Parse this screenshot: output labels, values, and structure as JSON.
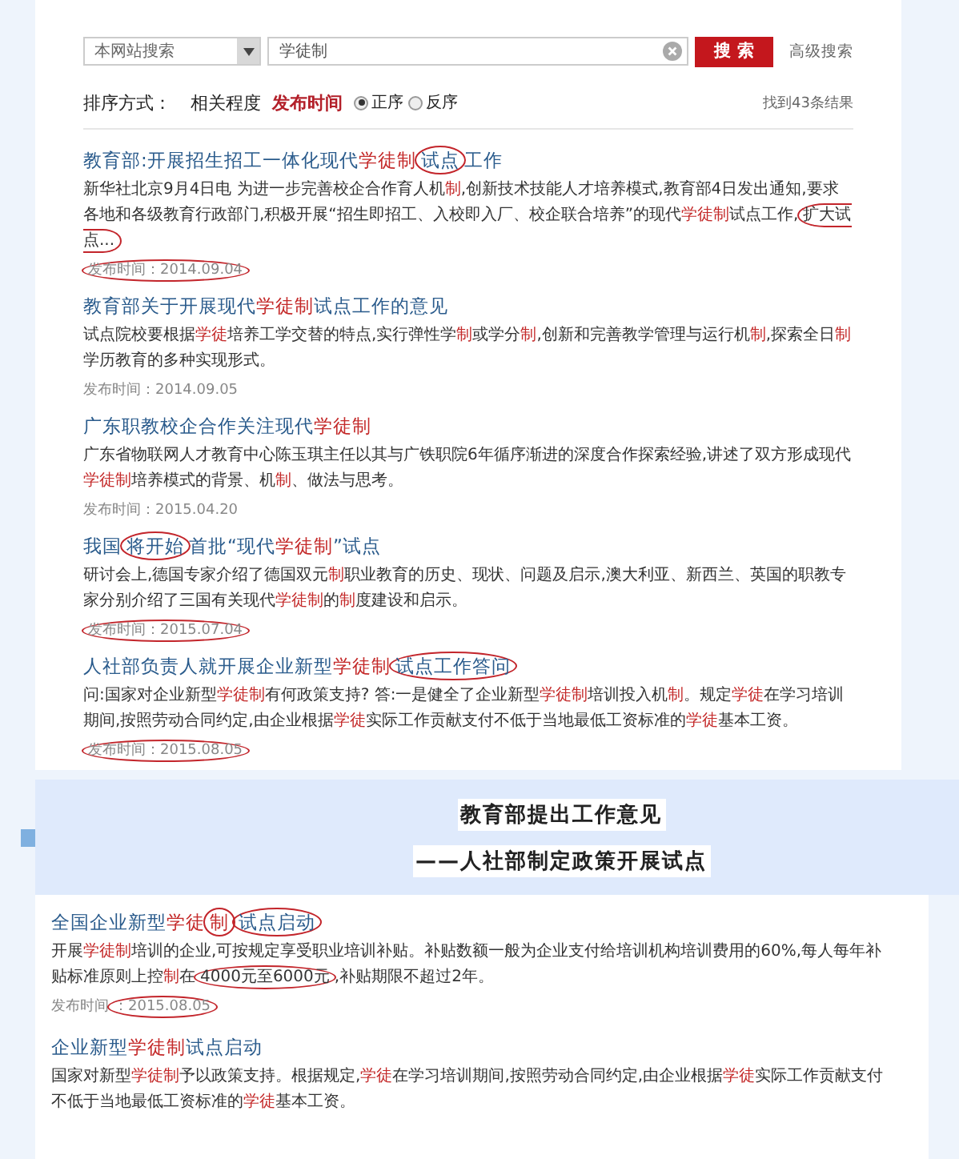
{
  "search": {
    "scope": "本网站搜索",
    "query": "学徒制",
    "button": "搜 索",
    "advanced": "高级搜索"
  },
  "sort": {
    "label": "排序方式：",
    "keys": [
      {
        "label": "相关程度",
        "selected": false
      },
      {
        "label": "发布时间",
        "selected": true
      }
    ],
    "orders": [
      {
        "label": "正序",
        "selected": true
      },
      {
        "label": "反序",
        "selected": false
      }
    ],
    "count": "找到43条结果"
  },
  "results": [
    {
      "title": [
        {
          "text": "教育部:开展招生招工一体化现代",
          "kind": "plain"
        },
        {
          "text": "学徒制",
          "kind": "keyword"
        },
        {
          "text": "试点",
          "kind": "circled"
        },
        {
          "text": "工作",
          "kind": "plain"
        }
      ],
      "snippet": [
        {
          "text": "新华社北京9月4日电 为进一步完善校企合作育人机",
          "kind": "plain"
        },
        {
          "text": "制",
          "kind": "keyword"
        },
        {
          "text": ",创新技术技能人才培养模式,教育部4日发出通知,要求各地和各级教育行政部门,积极开展“招生即招工、入校即入厂、校企联合培养”的现代",
          "kind": "plain"
        },
        {
          "text": "学徒制",
          "kind": "keyword"
        },
        {
          "text": "试点工作,",
          "kind": "plain"
        },
        {
          "text": "扩大试点...",
          "kind": "circled"
        }
      ],
      "date": [
        {
          "text": "发布时间：2014.09.04",
          "kind": "circled"
        }
      ]
    },
    {
      "title": [
        {
          "text": "教育部关于开展现代",
          "kind": "plain"
        },
        {
          "text": "学徒制",
          "kind": "keyword"
        },
        {
          "text": "试点工作的意见",
          "kind": "plain"
        }
      ],
      "snippet": [
        {
          "text": "试点院校要根据",
          "kind": "plain"
        },
        {
          "text": "学徒",
          "kind": "keyword"
        },
        {
          "text": "培养工学交替的特点,实行弹性学",
          "kind": "plain"
        },
        {
          "text": "制",
          "kind": "keyword"
        },
        {
          "text": "或学分",
          "kind": "plain"
        },
        {
          "text": "制",
          "kind": "keyword"
        },
        {
          "text": ",创新和完善教学管理与运行机",
          "kind": "plain"
        },
        {
          "text": "制",
          "kind": "keyword"
        },
        {
          "text": ",探索全日",
          "kind": "plain"
        },
        {
          "text": "制",
          "kind": "keyword"
        },
        {
          "text": "学历教育的多种实现形式。",
          "kind": "plain"
        }
      ],
      "date": [
        {
          "text": "发布时间：2014.09.05",
          "kind": "plain"
        }
      ]
    },
    {
      "title": [
        {
          "text": "广东职教校企合作关注现代",
          "kind": "plain"
        },
        {
          "text": "学徒制",
          "kind": "keyword"
        }
      ],
      "snippet": [
        {
          "text": "广东省物联网人才教育中心陈玉琪主任以其与广铁职院6年循序渐进的深度合作探索经验,讲述了双方形成现代",
          "kind": "plain"
        },
        {
          "text": "学徒制",
          "kind": "keyword"
        },
        {
          "text": "培养模式的背景、机",
          "kind": "plain"
        },
        {
          "text": "制",
          "kind": "keyword"
        },
        {
          "text": "、做法与思考。",
          "kind": "plain"
        }
      ],
      "date": [
        {
          "text": "发布时间：2015.04.20",
          "kind": "plain"
        }
      ]
    },
    {
      "title": [
        {
          "text": "我国",
          "kind": "plain"
        },
        {
          "text": "将开始",
          "kind": "circled"
        },
        {
          "text": "首批“现代",
          "kind": "plain"
        },
        {
          "text": "学徒制",
          "kind": "keyword"
        },
        {
          "text": "”试点",
          "kind": "plain"
        }
      ],
      "snippet": [
        {
          "text": "研讨会上,德国专家介绍了德国双元",
          "kind": "plain"
        },
        {
          "text": "制",
          "kind": "keyword"
        },
        {
          "text": "职业教育的历史、现状、问题及启示,澳大利亚、新西兰、英国的职教专家分别介绍了三国有关现代",
          "kind": "plain"
        },
        {
          "text": "学徒制",
          "kind": "keyword"
        },
        {
          "text": "的",
          "kind": "plain"
        },
        {
          "text": "制",
          "kind": "keyword"
        },
        {
          "text": "度建设和启示。",
          "kind": "plain"
        }
      ],
      "date": [
        {
          "text": "发布时间：2015.07.04",
          "kind": "circled"
        }
      ]
    },
    {
      "title": [
        {
          "text": "人社部负责人就开展企业新型",
          "kind": "plain"
        },
        {
          "text": "学徒制",
          "kind": "keyword"
        },
        {
          "text": "试点工作答问",
          "kind": "circled"
        }
      ],
      "snippet": [
        {
          "text": "问:国家对企业新型",
          "kind": "plain"
        },
        {
          "text": "学徒制",
          "kind": "keyword"
        },
        {
          "text": "有何政策支持? 答:一是健全了企业新型",
          "kind": "plain"
        },
        {
          "text": "学徒制",
          "kind": "keyword"
        },
        {
          "text": "培训投入机",
          "kind": "plain"
        },
        {
          "text": "制",
          "kind": "keyword"
        },
        {
          "text": "。规定",
          "kind": "plain"
        },
        {
          "text": "学徒",
          "kind": "keyword"
        },
        {
          "text": "在学习培训期间,按照劳动合同约定,由企业根据",
          "kind": "plain"
        },
        {
          "text": "学徒",
          "kind": "keyword"
        },
        {
          "text": "实际工作贡献支付不低于当地最低工资标准的",
          "kind": "plain"
        },
        {
          "text": "学徒",
          "kind": "keyword"
        },
        {
          "text": "基本工资。",
          "kind": "plain"
        }
      ],
      "date": [
        {
          "text": "发布时间：2015.08.05",
          "kind": "circled"
        }
      ]
    }
  ],
  "banner": {
    "headline": "教育部提出工作意见",
    "subheadline": "——人社部制定政策开展试点"
  },
  "more_results": [
    {
      "title": [
        {
          "text": "全国企业新型",
          "kind": "plain"
        },
        {
          "text": "学徒",
          "kind": "keyword"
        },
        {
          "text": "制",
          "kind": "keyword-circled"
        },
        {
          "text": "试点启动",
          "kind": "circled"
        }
      ],
      "snippet": [
        {
          "text": "开展",
          "kind": "plain"
        },
        {
          "text": "学徒制",
          "kind": "keyword"
        },
        {
          "text": "培训的企业,可按规定享受职业培训补贴。补贴数额一般为企业支付给培训机构培训费用的60%,每人每年补贴标准原则上控",
          "kind": "plain"
        },
        {
          "text": "制",
          "kind": "keyword"
        },
        {
          "text": "在",
          "kind": "plain"
        },
        {
          "text": "4000元至6000元",
          "kind": "circled"
        },
        {
          "text": ",补贴期限不超过2年。",
          "kind": "plain"
        }
      ],
      "date": [
        {
          "text": "发布时间",
          "kind": "plain"
        },
        {
          "text": "：2015.08.05",
          "kind": "circled"
        }
      ]
    },
    {
      "title": [
        {
          "text": "企业新型",
          "kind": "plain"
        },
        {
          "text": "学徒制",
          "kind": "keyword"
        },
        {
          "text": "试点启动",
          "kind": "plain"
        }
      ],
      "snippet": [
        {
          "text": "国家对新型",
          "kind": "plain"
        },
        {
          "text": "学徒制",
          "kind": "keyword"
        },
        {
          "text": "予以政策支持。根据规定,",
          "kind": "plain"
        },
        {
          "text": "学徒",
          "kind": "keyword"
        },
        {
          "text": "在学习培训期间,按照劳动合同约定,由企业根据",
          "kind": "plain"
        },
        {
          "text": "学徒",
          "kind": "keyword"
        },
        {
          "text": "实际工作贡献支付不低于当地最低工资标准的",
          "kind": "plain"
        },
        {
          "text": "学徒",
          "kind": "keyword"
        },
        {
          "text": "基本工资。",
          "kind": "plain"
        }
      ]
    }
  ]
}
